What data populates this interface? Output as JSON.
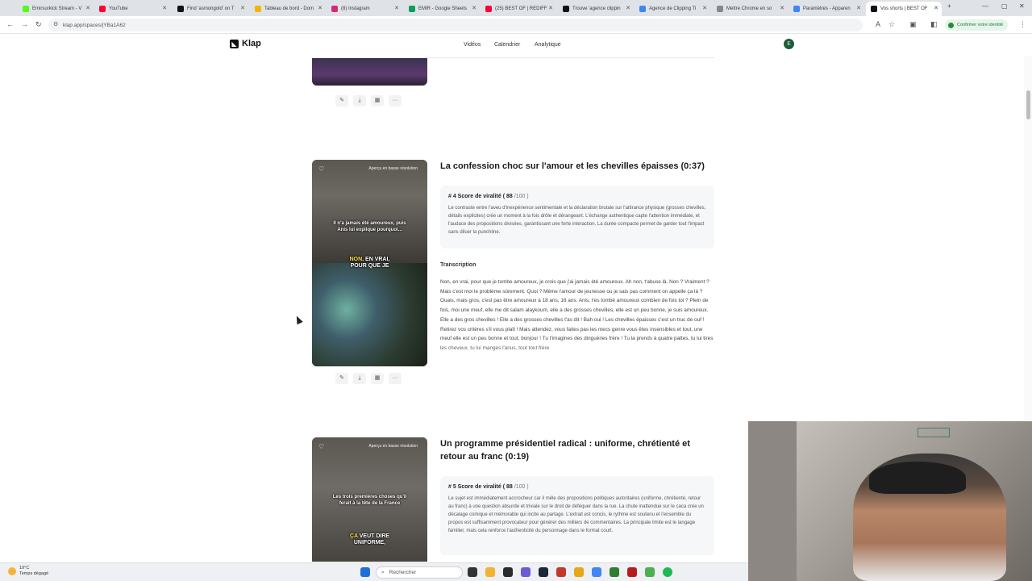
{
  "browser": {
    "tabs": [
      {
        "label": "Emirsurkick Stream - V",
        "color": "#53fc18"
      },
      {
        "label": "YouTube",
        "color": "#ff0033"
      },
      {
        "label": "Find 'asmongold' on T",
        "color": "#111111"
      },
      {
        "label": "Tableau de bord - Dom",
        "color": "#f4b400"
      },
      {
        "label": "(8) Instagram",
        "color": "#d62976"
      },
      {
        "label": "EMIR - Google Sheets",
        "color": "#0f9d58"
      },
      {
        "label": "(25) BEST OF | REDIFF",
        "color": "#ff0033"
      },
      {
        "label": "Trouve 'agence clippin",
        "color": "#111111"
      },
      {
        "label": "Agence de Clipping Ti",
        "color": "#4285f4"
      },
      {
        "label": "Mettre Chrome en so",
        "color": "#888888"
      },
      {
        "label": "Paramètres - Apparen",
        "color": "#4285f4"
      },
      {
        "label": "Vos shorts | BEST OF",
        "color": "#111111"
      }
    ],
    "url": "klap.app/spaces/jYBa1A62",
    "identity_label": "Confirmer votre identité"
  },
  "app": {
    "logo": "Klap",
    "nav": [
      "Vidéos",
      "Calendrier",
      "Analytique"
    ],
    "avatar_initial": "E"
  },
  "clips": [
    {
      "title": "La confession choc sur l'amour et les chevilles épaisses (0:37)",
      "rank_label": "# 4 Score de viralité",
      "score": "( 88",
      "score_max": "/100 )",
      "explanation": "Le contraste entre l'aveu d'inexpérience sentimentale et la déclaration brutale sur l'attirance physique (grosses chevilles, détails explicites) crée un moment à la fois drôle et dérangeant. L'échange authentique capte l'attention immédiate, et l'audace des propositions divisées, garantissant une forte interaction. La durée compacte permet de garder tout l'impact sans diluer la punchline.",
      "transcription_label": "Transcription",
      "transcription": "Non, en vrai, pour que je tombe amoureux, je crois que j'ai jamais été amoureux. Ah non, t'abuse là. Non ? Vraiment ? Mais c'est moi le problème sûrement. Quoi ? Même l'amour de jeunesse ou je sais pas comment on appelle ça là ? Ouais, mais gros, c'est pas être amoureux à 18 ans, 16 ans. Anis, t'es tombé amoureux combien de fois toi ? Plein de fois, moi une meuf, elle me dit salam alaykoum, elle a des grosses chevilles, elle est un peu bonne, je suis amoureux. Elle a des gros chevilles ! Elle a des grosses chevilles t'as dit ! Bah oui ! Les chevilles épaisses c'est un truc de ouf ! Retirez vos critères s'il vous plaît ! Mais attendez, vous faites pas les mecs genre vous êtes insensibles et tout, une meuf elle est un peu bonne et tout, bonjour ! Tu t'imagines des dinguèries frère ! Tu la prends à quatre pattes, tu lui tires les cheveux, tu lui manges l'anus, tout tout frère",
      "preview_label": "Aperçu en basse résolution",
      "caption_top": "Il n'a jamais été amoureux, puis Anis lui explique pourquoi...",
      "caption_hl": "NON,",
      "caption_rest": " EN VRAI, POUR QUE JE"
    },
    {
      "title": "Un programme présidentiel radical : uniforme, chrétienté et retour au franc (0:19)",
      "rank_label": "# 5 Score de viralité",
      "score": "( 88",
      "score_max": "/100 )",
      "explanation": "Le sujet est immédiatement accrocheur car il mêle des propositions politiques autoritaires (uniforme, chrétienté, retour au franc) à une question absurde et triviale sur le droit de déféquer dans la rue. La chute inattendue sur le caca crée un décalage comique et mémorable qui incite au partage. L'extrait est concis, le rythme est soutenu et l'ensemble du propos est suffisamment provocateur pour générer des milliers de commentaires. La principale limite est le langage familier, mais cela renforce l'authenticité du personnage dans le format court.",
      "preview_label": "Aperçu en basse résolution",
      "caption_top": "Les trois premières choses qu'il ferait à la tête de la France",
      "caption_hl": "ÇA",
      "caption_rest": " VEUT DIRE UNIFORME,"
    }
  ],
  "taskbar": {
    "temperature": "19°C",
    "weather": "Temps dégagé",
    "search_placeholder": "Rechercher"
  }
}
